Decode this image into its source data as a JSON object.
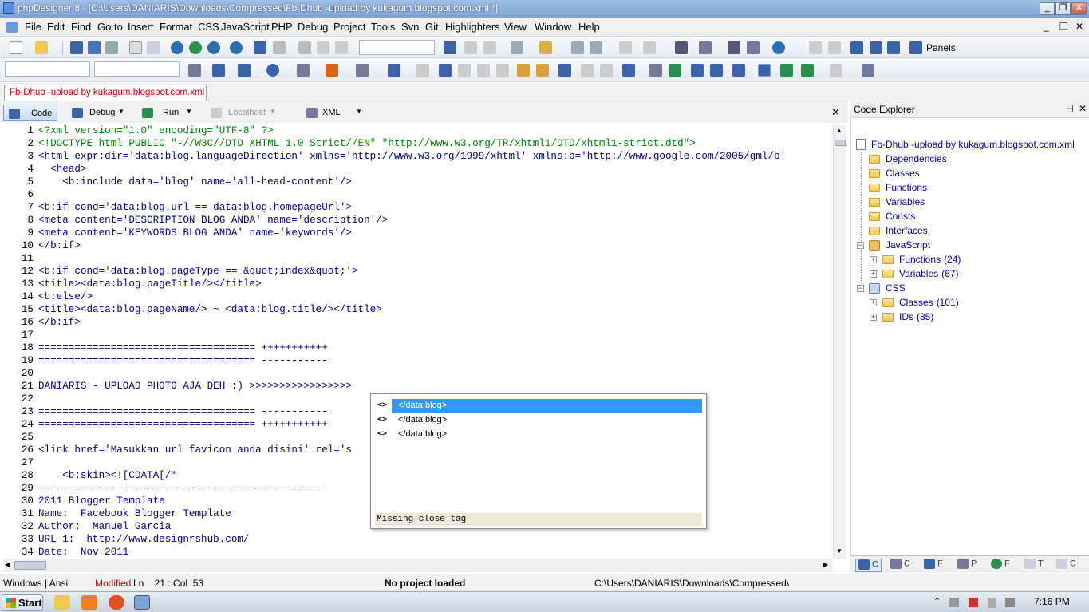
{
  "window": {
    "title": "phpDesigner 8 - [C:\\Users\\DANIARIS\\Downloads\\Compressed\\Fb-Dhub -upload by kukagum.blogspot.com.xml *]",
    "controls": [
      "_",
      "❐",
      "✕"
    ]
  },
  "menu": {
    "items": [
      "File",
      "Edit",
      "Find",
      "Go to",
      "Insert",
      "Format",
      "CSS",
      "JavaScript",
      "PHP",
      "Debug",
      "Project",
      "Tools",
      "Svn",
      "Git",
      "Highlighters",
      "View",
      "Window",
      "Help"
    ],
    "mdi_controls": [
      "_",
      "❐",
      "✕"
    ]
  },
  "toolbar": {
    "panels_label": "Panels"
  },
  "document_tab": {
    "label": "Fb-Dhub -upload by kukagum.blogspot.com.xml"
  },
  "editor_toolbar": {
    "code": "Code",
    "debug": "Debug",
    "run": "Run",
    "localhost": "Localhost",
    "xml": "XML",
    "close": "✕"
  },
  "code_lines": [
    {
      "n": "1",
      "text": "<?xml version=\"1.0\" encoding=\"UTF-8\" ?>"
    },
    {
      "n": "2",
      "text": "<!DOCTYPE html PUBLIC \"-//W3C//DTD XHTML 1.0 Strict//EN\" \"http://www.w3.org/TR/xhtml1/DTD/xhtml1-strict.dtd\">"
    },
    {
      "n": "3",
      "text": "<html expr:dir='data:blog.languageDirection' xmlns='http://www.w3.org/1999/xhtml' xmlns:b='http://www.google.com/2005/gml/b'"
    },
    {
      "n": "4",
      "text": "  <head>"
    },
    {
      "n": "5",
      "text": "    <b:include data='blog' name='all-head-content'/>"
    },
    {
      "n": "6",
      "text": ""
    },
    {
      "n": "7",
      "text": "<b:if cond='data:blog.url == data:blog.homepageUrl'>"
    },
    {
      "n": "8",
      "text": "<meta content='DESCRIPTION BLOG ANDA' name='description'/>"
    },
    {
      "n": "9",
      "text": "<meta content='KEYWORDS BLOG ANDA' name='keywords'/>"
    },
    {
      "n": "10",
      "text": "</b:if>"
    },
    {
      "n": "11",
      "text": ""
    },
    {
      "n": "12",
      "text": "<b:if cond='data:blog.pageType == &quot;index&quot;'>"
    },
    {
      "n": "13",
      "text": "<title><data:blog.pageTitle/></title>"
    },
    {
      "n": "14",
      "text": "<b:else/>"
    },
    {
      "n": "15",
      "text": "<title><data:blog.pageName/> ~ <data:blog.title/></title>"
    },
    {
      "n": "16",
      "text": "</b:if>"
    },
    {
      "n": "17",
      "text": ""
    },
    {
      "n": "18",
      "text": "==================================== +++++++++++"
    },
    {
      "n": "19",
      "text": "==================================== -----------"
    },
    {
      "n": "20",
      "text": ""
    },
    {
      "n": "21",
      "text": "DANIARIS - UPLOAD PHOTO AJA DEH :) >>>>>>>>>>>>>>>>>"
    },
    {
      "n": "22",
      "text": ""
    },
    {
      "n": "23",
      "text": "==================================== -----------"
    },
    {
      "n": "24",
      "text": "==================================== +++++++++++"
    },
    {
      "n": "25",
      "text": ""
    },
    {
      "n": "26",
      "text": "<link href='Masukkan url favicon anda disini' rel='s"
    },
    {
      "n": "27",
      "text": ""
    },
    {
      "n": "28",
      "text": "    <b:skin><![CDATA[/*"
    },
    {
      "n": "29",
      "text": "-----------------------------------------------"
    },
    {
      "n": "30",
      "text": "2011 Blogger Template"
    },
    {
      "n": "31",
      "text": "Name:  Facebook Blogger Template"
    },
    {
      "n": "32",
      "text": "Author:  Manuel Garcia"
    },
    {
      "n": "33",
      "text": "URL 1:  http://www.designrshub.com/"
    },
    {
      "n": "34",
      "text": "Date:  Nov 2011"
    }
  ],
  "autocomplete": {
    "items": [
      "</data:blog>",
      "</data:blog>",
      "</data:blog>"
    ],
    "status": "Missing close tag"
  },
  "code_explorer": {
    "title": "Code Explorer",
    "root": "Fb-Dhub -upload by kukagum.blogspot.com.xml",
    "nodes": {
      "dependencies": "Dependencies",
      "classes": "Classes",
      "functions": "Functions",
      "variables": "Variables",
      "consts": "Consts",
      "interfaces": "Interfaces",
      "javascript": "JavaScript",
      "js_functions": "Functions",
      "js_functions_count": "(24)",
      "js_variables": "Variables",
      "js_variables_count": "(67)",
      "css": "CSS",
      "css_classes": "Classes",
      "css_classes_count": "(101)",
      "css_ids": "IDs",
      "css_ids_count": "(35)"
    },
    "tabs": [
      "C",
      "C",
      "F",
      "P",
      "F",
      "T",
      "C"
    ]
  },
  "statusbar": {
    "encoding": "Windows | Ansi",
    "modified": "Modified",
    "position": "Ln    21 : Col  53",
    "project": "No project loaded",
    "path": "C:\\Users\\DANIARIS\\Downloads\\Compressed\\"
  },
  "taskbar": {
    "start": "Start",
    "clock": "7:16 PM"
  }
}
